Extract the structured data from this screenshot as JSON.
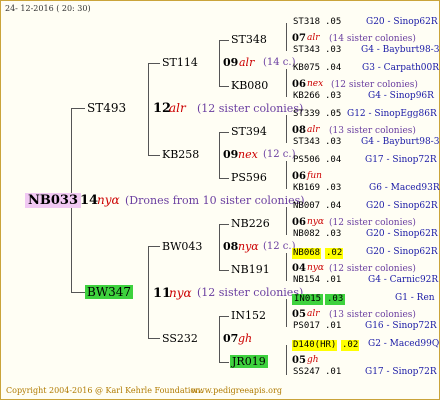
{
  "header": {
    "date_text": "24- 12-2016 ( 20: 30)"
  },
  "footer": {
    "copyright": "Copyright 2004-2016 @ Karl Kehrle Foundation.",
    "site": "www.pedigreeapis.org"
  },
  "gen1": {
    "name": "NB033",
    "num": "14",
    "race": "nyα",
    "note": "(Drones from 10 sister colonies)"
  },
  "gen2": [
    {
      "name": "ST493",
      "num": "12",
      "race": "alr",
      "note": "(12 sister colonies)"
    },
    {
      "name": "BW347",
      "num": "11",
      "race": "nyα",
      "note": "(12 sister colonies)"
    }
  ],
  "gen3": [
    {
      "name": "ST114",
      "num": "09",
      "race": "alr",
      "note": "(14 c.)"
    },
    {
      "name": "KB258",
      "num": "09",
      "race": "nex",
      "note": "(12 c.)"
    },
    {
      "name": "BW043",
      "num": "08",
      "race": "nyα",
      "note": "(12 c.)"
    },
    {
      "name": "SS232",
      "num": "07",
      "race": "gh",
      "note": ""
    }
  ],
  "gen4": [
    {
      "name": "ST348",
      "num": "07",
      "race": "alr",
      "note": "(14 sister colonies)"
    },
    {
      "name": "KB080",
      "num": "06",
      "race": "nex",
      "note": "(12 sister colonies)"
    },
    {
      "name": "ST394",
      "num": "08",
      "race": "alr",
      "note": "(13 sister colonies)"
    },
    {
      "name": "PS596",
      "num": "06",
      "race": "fun",
      "note": ""
    },
    {
      "name": "NB226",
      "num": "06",
      "race": "nyα",
      "note": "(12 sister colonies)"
    },
    {
      "name": "NB191",
      "num": "04",
      "race": "nyα",
      "note": "(12 sister colonies)"
    },
    {
      "name": "IN152",
      "num": "05",
      "race": "alr",
      "note": "(13 sister colonies)"
    },
    {
      "name": "JR019",
      "num": "05",
      "race": "gh",
      "note": ""
    }
  ],
  "gen5": [
    {
      "name": "ST318",
      "yr": ".05",
      "loc": "G20 - Sinop62R"
    },
    {
      "name": "ST343",
      "yr": ".03",
      "loc": "G4 - Bayburt98-3"
    },
    {
      "name": "KB075",
      "yr": ".04",
      "loc": "G3 - Carpath00R"
    },
    {
      "name": "KB266",
      "yr": ".03",
      "loc": "G4 - Sinop96R"
    },
    {
      "name": "ST339",
      "yr": ".05",
      "loc": "G12 - SinopEgg86R"
    },
    {
      "name": "ST343",
      "yr": ".03",
      "loc": "G4 - Bayburt98-3"
    },
    {
      "name": "PS506",
      "yr": ".04",
      "loc": "G17 - Sinop72R"
    },
    {
      "name": "KB169",
      "yr": ".03",
      "loc": "G6 - Maced93R"
    },
    {
      "name": "NB007",
      "yr": ".04",
      "loc": "G20 - Sinop62R"
    },
    {
      "name": "NB082",
      "yr": ".03",
      "loc": "G20 - Sinop62R"
    },
    {
      "name": "NB068",
      "yr": ".02",
      "loc": "G20 - Sinop62R"
    },
    {
      "name": "NB154",
      "yr": ".01",
      "loc": "G4 - Carnic92R"
    },
    {
      "name": "IN015",
      "yr": ".03",
      "loc": "G1 - Ren"
    },
    {
      "name": "PS017",
      "yr": ".01",
      "loc": "G16 - Sinop72R"
    },
    {
      "name": "D140(HR)",
      "yr": ".02",
      "loc": "G2 - Maced99Q"
    },
    {
      "name": "SS247",
      "yr": ".01",
      "loc": "G17 - Sinop72R"
    }
  ]
}
